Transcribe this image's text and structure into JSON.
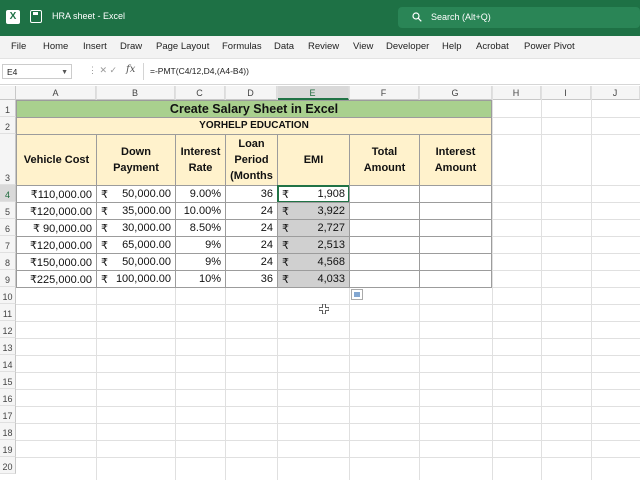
{
  "app": {
    "title": "HRA sheet  -  Excel",
    "search_placeholder": "Search (Alt+Q)",
    "logo_letter": "X"
  },
  "menu": [
    "File",
    "Home",
    "Insert",
    "Draw",
    "Page Layout",
    "Formulas",
    "Data",
    "Review",
    "View",
    "Developer",
    "Help",
    "Acrobat",
    "Power Pivot"
  ],
  "formula_bar": {
    "cell_ref": "E4",
    "fx": "fx",
    "formula": "=-PMT(C4/12,D4,(A4-B4))"
  },
  "columns": [
    "A",
    "B",
    "C",
    "D",
    "E",
    "F",
    "G",
    "H",
    "I",
    "J"
  ],
  "rows": [
    "1",
    "2",
    "3",
    "4",
    "5",
    "6",
    "7",
    "8",
    "9",
    "10",
    "11",
    "12",
    "13",
    "14",
    "15",
    "16",
    "17",
    "18",
    "19",
    "20"
  ],
  "sheet": {
    "title": "Create Salary Sheet in Excel",
    "subtitle": "YORHELP EDUCATION",
    "headers": {
      "vehicle_cost": "Vehicle Cost",
      "down_payment": "Down Payment",
      "interest_rate": "Interest Rate",
      "loan_period": "Loan Period (Months",
      "emi": "EMI",
      "total_amount": "Total Amount",
      "interest_amount": "Interest Amount"
    },
    "currency_symbol": "₹",
    "data_rows": [
      {
        "vehicle_cost": "₹110,000.00",
        "down_payment": "50,000.00",
        "interest_rate": "9.00%",
        "loan_period": "36",
        "emi": "1,908"
      },
      {
        "vehicle_cost": "₹120,000.00",
        "down_payment": "35,000.00",
        "interest_rate": "10.00%",
        "loan_period": "24",
        "emi": "3,922"
      },
      {
        "vehicle_cost": "₹  90,000.00",
        "down_payment": "30,000.00",
        "interest_rate": "8.50%",
        "loan_period": "24",
        "emi": "2,727"
      },
      {
        "vehicle_cost": "₹120,000.00",
        "down_payment": "65,000.00",
        "interest_rate": "9%",
        "loan_period": "24",
        "emi": "2,513"
      },
      {
        "vehicle_cost": "₹150,000.00",
        "down_payment": "50,000.00",
        "interest_rate": "9%",
        "loan_period": "24",
        "emi": "4,568"
      },
      {
        "vehicle_cost": "₹225,000.00",
        "down_payment": "100,000.00",
        "interest_rate": "10%",
        "loan_period": "36",
        "emi": "4,033"
      }
    ]
  },
  "colors": {
    "title_bar": "#1e7145",
    "header_green": "#a9d08e",
    "header_yellow": "#fff2cc",
    "selection": "#217346"
  }
}
